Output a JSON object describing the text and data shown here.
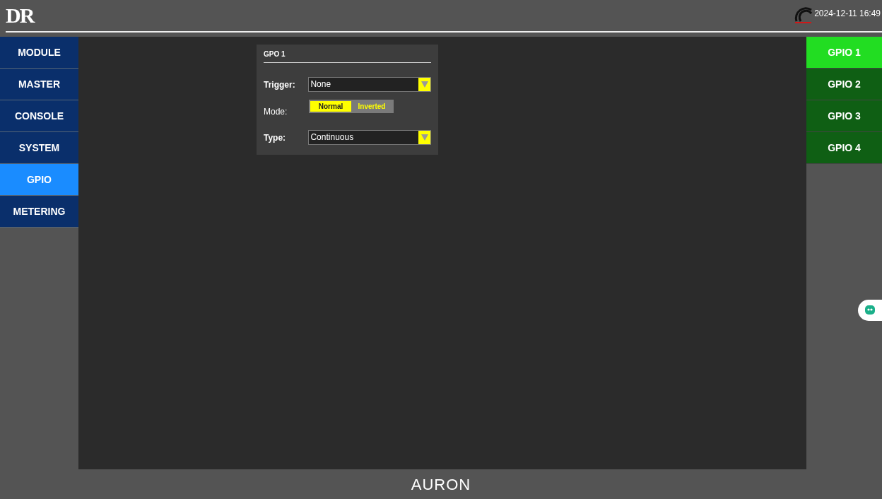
{
  "header": {
    "logo": "DR",
    "datetime": "2024-12-11 16:49"
  },
  "sidebar": {
    "items": [
      {
        "label": "MODULE",
        "selected": false
      },
      {
        "label": "MASTER",
        "selected": false
      },
      {
        "label": "CONSOLE",
        "selected": false
      },
      {
        "label": "SYSTEM",
        "selected": false
      },
      {
        "label": "GPIO",
        "selected": true
      },
      {
        "label": "METERING",
        "selected": false
      }
    ]
  },
  "panel": {
    "title": "GPO 1",
    "trigger": {
      "label": "Trigger:",
      "value": "None"
    },
    "mode": {
      "label": "Mode:",
      "options": [
        {
          "label": "Normal",
          "selected": true
        },
        {
          "label": "Inverted",
          "selected": false
        }
      ]
    },
    "type": {
      "label": "Type:",
      "value": "Continuous"
    }
  },
  "right_tabs": [
    {
      "label": "GPIO 1",
      "selected": true
    },
    {
      "label": "GPIO 2",
      "selected": false
    },
    {
      "label": "GPIO 3",
      "selected": false
    },
    {
      "label": "GPIO 4",
      "selected": false
    }
  ],
  "footer": {
    "brand": "AURON"
  }
}
